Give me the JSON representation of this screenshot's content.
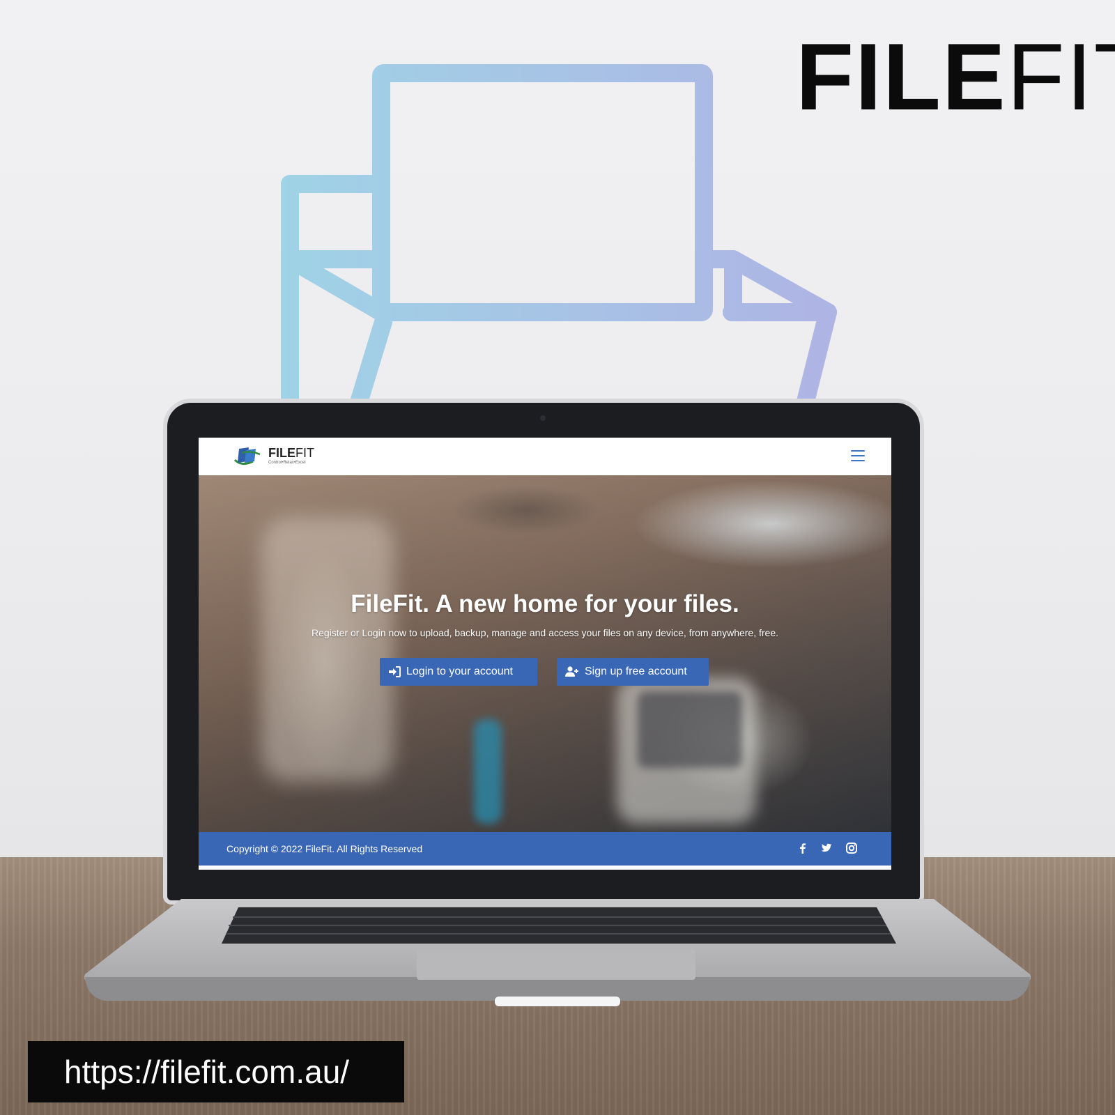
{
  "brand": {
    "bold": "FILE",
    "thin": "FIT"
  },
  "site": {
    "logo": {
      "bold": "FILE",
      "thin": "FIT",
      "tagline": "Control•Relax•Excel"
    },
    "hero": {
      "title": "FileFit. A new home for your files.",
      "subtitle": "Register or Login now to upload, backup, manage and access your files on any device, from anywhere, free.",
      "login_label": "Login to your account",
      "signup_label": "Sign up free account"
    },
    "footer": {
      "copyright": "Copyright © 2022 FileFit. All Rights Reserved",
      "social": [
        "facebook-icon",
        "twitter-icon",
        "instagram-icon"
      ]
    },
    "colors": {
      "primary": "#3a67b5",
      "menu": "#3a75c4"
    }
  },
  "url": "https://filefit.com.au/",
  "colors": {
    "illustration_start": "#9fd3e6",
    "illustration_end": "#aeb4e4",
    "badge_bg": "#0a0a0a"
  }
}
